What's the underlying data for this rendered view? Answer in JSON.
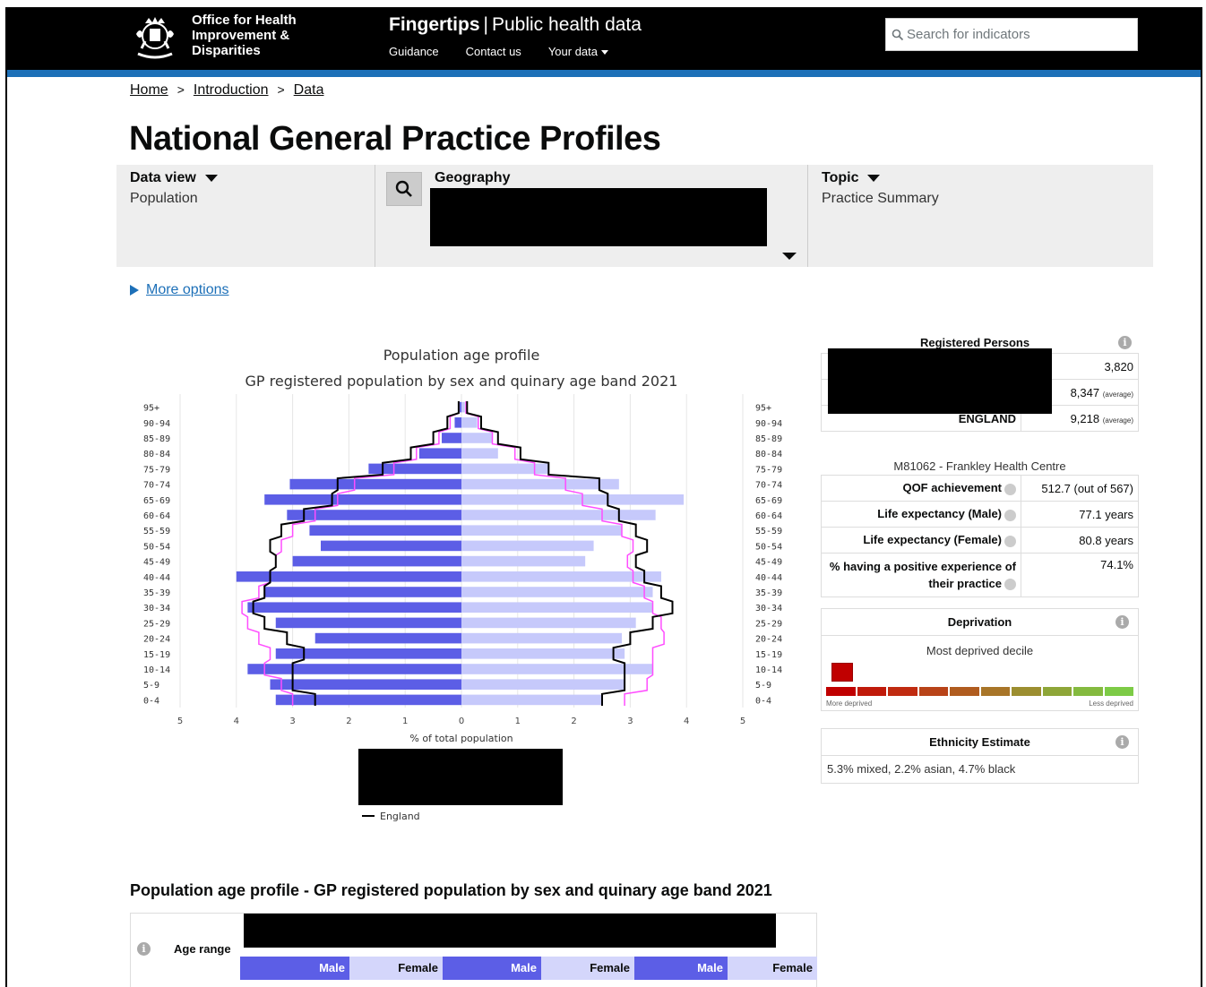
{
  "header": {
    "org_line1": "Office for Health",
    "org_line2": "Improvement &",
    "org_line3": "Disparities",
    "brand_main": "Fingertips",
    "brand_sep": "|",
    "brand_sub": "Public health data",
    "nav": [
      "Guidance",
      "Contact us",
      "Your data"
    ],
    "search_placeholder": "Search for indicators"
  },
  "breadcrumb": [
    "Home",
    "Introduction",
    "Data"
  ],
  "page_title": "National General Practice Profiles",
  "filters": {
    "data_view_label": "Data view",
    "data_view_value": "Population",
    "geography_label": "Geography",
    "topic_label": "Topic",
    "topic_value": "Practice Summary"
  },
  "more_options": "More options",
  "chart_data": {
    "type": "bar",
    "title": "Population age profile",
    "subtitle": "GP registered population by sex and quinary age band 2021",
    "xlabel": "% of total population",
    "x_ticks": [
      5,
      4,
      3,
      2,
      1,
      0,
      1,
      2,
      3,
      4,
      5
    ],
    "xlim": [
      -5,
      5
    ],
    "categories": [
      "0-4",
      "5-9",
      "10-14",
      "15-19",
      "20-24",
      "25-29",
      "30-34",
      "35-39",
      "40-44",
      "45-49",
      "50-54",
      "55-59",
      "60-64",
      "65-69",
      "70-74",
      "75-79",
      "80-84",
      "85-89",
      "90-94",
      "95+"
    ],
    "series": [
      {
        "values": [
          3.3,
          3.4,
          3.8,
          3.3,
          2.6,
          3.3,
          3.8,
          3.5,
          4.0,
          3.0,
          2.5,
          2.7,
          3.1,
          3.5,
          3.05,
          1.65,
          0.75,
          0.35,
          0.12,
          0.03
        ],
        "color": "#5c5ee6"
      },
      {
        "values": [
          2.5,
          2.9,
          3.4,
          2.9,
          2.85,
          3.1,
          3.4,
          3.4,
          3.55,
          2.2,
          2.35,
          2.85,
          3.45,
          3.95,
          2.8,
          1.55,
          0.65,
          0.55,
          0.28,
          0.06
        ],
        "color": "#c6c9fb"
      },
      {
        "name": "England",
        "color": "#000000",
        "male": [
          2.6,
          3.0,
          3.0,
          2.8,
          3.1,
          3.5,
          3.7,
          3.5,
          3.4,
          3.3,
          3.4,
          3.2,
          2.8,
          2.3,
          2.2,
          1.4,
          0.9,
          0.5,
          0.25,
          0.05
        ],
        "female": [
          2.5,
          2.9,
          2.9,
          2.7,
          3.0,
          3.4,
          3.75,
          3.55,
          3.25,
          3.1,
          3.3,
          3.1,
          2.8,
          2.6,
          2.45,
          1.55,
          1.05,
          0.65,
          0.35,
          0.1
        ]
      },
      {
        "color": "#ff4dff",
        "male": [
          3.0,
          3.2,
          3.5,
          3.4,
          3.6,
          3.8,
          3.9,
          3.6,
          3.4,
          3.3,
          3.2,
          3.0,
          2.6,
          2.2,
          1.9,
          1.2,
          0.8,
          0.4,
          0.2,
          0.05
        ],
        "female": [
          2.9,
          3.3,
          3.4,
          3.4,
          3.6,
          3.55,
          3.4,
          3.25,
          3.05,
          2.95,
          3.05,
          2.85,
          2.5,
          2.15,
          1.85,
          1.3,
          0.95,
          0.55,
          0.3,
          0.08
        ]
      }
    ],
    "legend": [
      "England"
    ]
  },
  "registered_persons": {
    "title": "Registered Persons",
    "rows": [
      {
        "label": "",
        "value": "3,820",
        "avg": ""
      },
      {
        "label": "",
        "value": "8,347",
        "avg": "(average)"
      },
      {
        "label": "ENGLAND",
        "value": "9,218",
        "avg": "(average)"
      }
    ]
  },
  "practice": {
    "name": "M81062 - Frankley Health Centre",
    "indicators": [
      {
        "label": "QOF achievement",
        "value": "512.7 (out of 567)"
      },
      {
        "label": "Life expectancy (Male)",
        "value": "77.1 years"
      },
      {
        "label": "Life expectancy (Female)",
        "value": "80.8 years"
      },
      {
        "label": "% having a positive experience of their practice",
        "value": "74.1%"
      }
    ]
  },
  "deprivation": {
    "title": "Deprivation",
    "subtitle": "Most deprived decile",
    "more": "More deprived",
    "less": "Less deprived",
    "colors": [
      "#c00000",
      "#c01a0a",
      "#c02b10",
      "#b84318",
      "#b05c1f",
      "#a87528",
      "#9c8e30",
      "#8ea638",
      "#84ba3f",
      "#7dcb46"
    ]
  },
  "ethnicity": {
    "title": "Ethnicity Estimate",
    "text": "5.3% mixed, 2.2% asian, 4.7% black"
  },
  "table_section": {
    "title": "Population age profile - GP registered population by sex and quinary age band 2021",
    "age_range": "Age range",
    "subheaders": [
      "Male",
      "Female",
      "Male",
      "Female",
      "Male",
      "Female"
    ]
  }
}
